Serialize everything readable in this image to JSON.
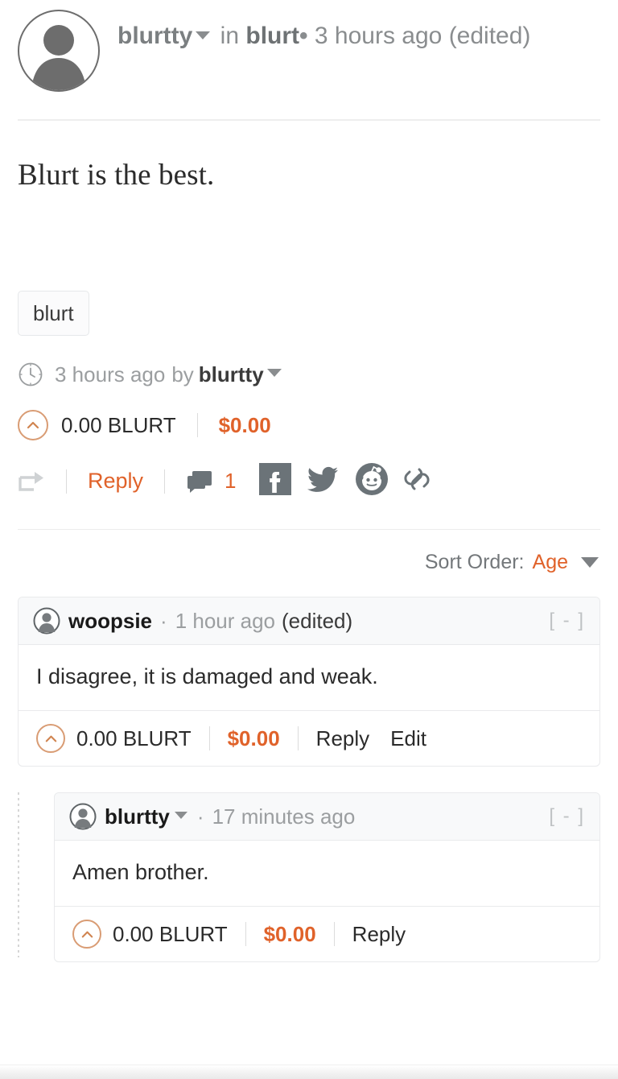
{
  "colors": {
    "accent": "#e0622a",
    "muted": "#9b9ea0",
    "text": "#2b2b2b",
    "border": "#e9eaec",
    "upvote_ring": "#d99c74",
    "social_gray": "#6b7378"
  },
  "post": {
    "author": "blurtty",
    "in_label": "in",
    "community": "blurt",
    "separator": "•",
    "age": "3 hours ago",
    "edited": "(edited)",
    "title": "Blurt is the best.",
    "tags": [
      "blurt"
    ],
    "meta": {
      "clock_icon": "clock-icon",
      "age": "3 hours ago",
      "by_label": "by",
      "author": "blurtty"
    },
    "vote": {
      "upvote_icon": "chevron-up-circle-icon",
      "amount": "0.00 BLURT",
      "payout": "$0.00"
    },
    "actions": {
      "reblog_icon": "reblog-arrow-icon",
      "reply_label": "Reply",
      "comment_icon": "comment-bubble-icon",
      "comment_count": "1",
      "share_icons": [
        {
          "name": "facebook-icon",
          "label": "Facebook"
        },
        {
          "name": "twitter-icon",
          "label": "Twitter"
        },
        {
          "name": "reddit-icon",
          "label": "Reddit"
        },
        {
          "name": "link-icon",
          "label": "Copy link"
        }
      ]
    }
  },
  "sort": {
    "label": "Sort Order:",
    "value": "Age",
    "caret_icon": "chevron-down-icon"
  },
  "comments": [
    {
      "avatar_icon": "avatar-icon",
      "author": "woopsie",
      "has_author_caret": false,
      "separator": "·",
      "age": "1 hour ago",
      "edited": "(edited)",
      "collapse": "[ - ]",
      "body": "I disagree, it is damaged and weak.",
      "upvote_icon": "chevron-up-circle-icon",
      "amount": "0.00 BLURT",
      "payout": "$0.00",
      "links": [
        "Reply",
        "Edit"
      ],
      "nested": false
    },
    {
      "avatar_icon": "avatar-icon",
      "author": "blurtty",
      "has_author_caret": true,
      "separator": "·",
      "age": "17 minutes ago",
      "edited": "",
      "collapse": "[ - ]",
      "body": "Amen brother.",
      "upvote_icon": "chevron-up-circle-icon",
      "amount": "0.00 BLURT",
      "payout": "$0.00",
      "links": [
        "Reply"
      ],
      "nested": true
    }
  ]
}
